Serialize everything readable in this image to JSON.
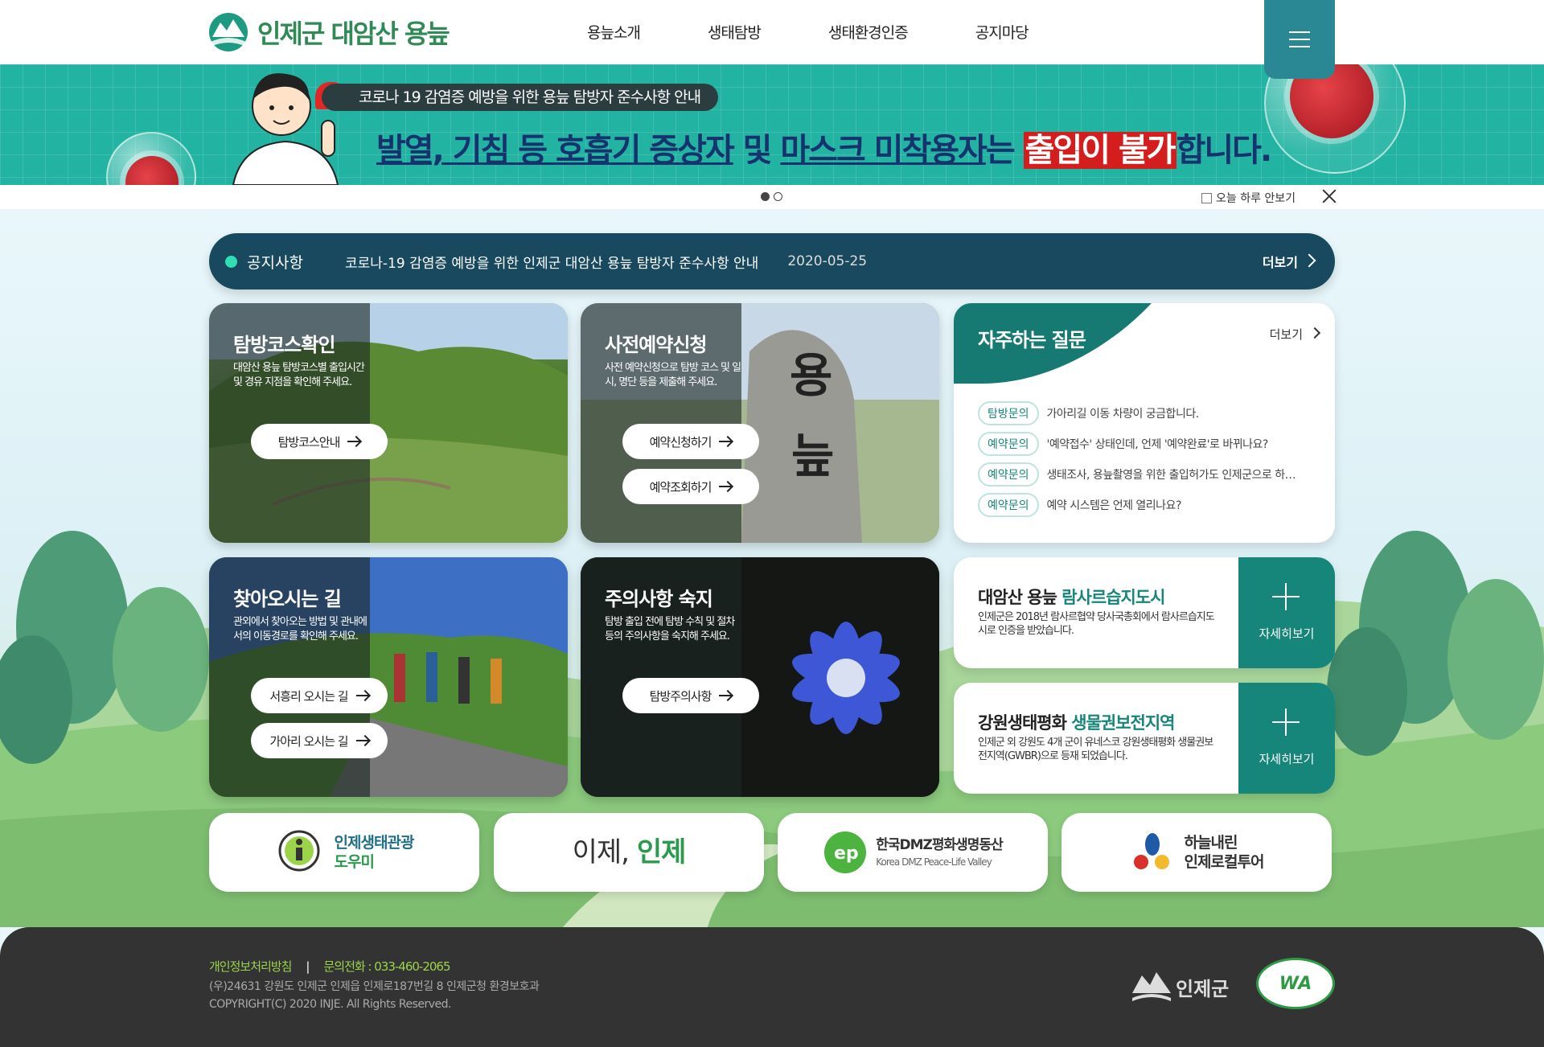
{
  "header": {
    "logo_text": "인제군 대암산 용늪",
    "nav": [
      "용늪소개",
      "생태탐방",
      "생태환경인증",
      "공지마당"
    ],
    "menu_icon": "hamburger-icon"
  },
  "banner": {
    "pill": "코로나 19 감염증 예방을 위한 용늪 탐방자 준수사항 안내",
    "headline_1": "발열, 기침 등 호흡기 증상자",
    "headline_2": " 및 ",
    "headline_3": "마스크 미착용자",
    "headline_4": "는 ",
    "headline_5": "출입이 불가",
    "headline_6": "합니다.",
    "slide_count": 2,
    "active_slide": 1,
    "today_hide": "오늘 하루 안보기"
  },
  "notice": {
    "label": "공지사항",
    "text": "코로나-19 감염증 예방을 위한 인제군 대암산 용늪 탐방자 준수사항 안내",
    "date": "2020-05-25",
    "more": "더보기"
  },
  "cards": [
    {
      "title": "탐방코스확인",
      "desc": "대암산 용늪 탐방코스별 출입시간 및 경유 지점을 확인해 주세요.",
      "buttons": [
        "탐방코스안내"
      ]
    },
    {
      "title": "사전예약신청",
      "desc": "사전 예약신청으로 탐방 코스 및 일시, 명단 등을 제출해 주세요.",
      "buttons": [
        "예약신청하기",
        "예약조회하기"
      ]
    },
    {
      "title": "찾아오시는 길",
      "desc": "관외에서 찾아오는 방법 및 관내에서의 이동경로를 확인해 주세요.",
      "buttons": [
        "서흥리 오시는 길",
        "가아리 오시는 길"
      ]
    },
    {
      "title": "주의사항 숙지",
      "desc": "탐방 출입 전에 탐방 수칙 및 절차 등의 주의사항을 숙지해 주세요.",
      "buttons": [
        "탐방주의사항"
      ]
    }
  ],
  "faq": {
    "title": "자주하는 질문",
    "more": "더보기",
    "items": [
      {
        "tag": "탐방문의",
        "q": "가아리길 이동 차량이 궁금합니다."
      },
      {
        "tag": "예약문의",
        "q": "'예약접수' 상태인데, 언제 '예약완료'로 바뀌나요?"
      },
      {
        "tag": "예약문의",
        "q": "생태조사, 용늪촬영을 위한 출입허가도 인제군으로 하나요?"
      },
      {
        "tag": "예약문의",
        "q": "예약 시스템은 언제 열리나요?"
      }
    ]
  },
  "info": [
    {
      "title_a": "대암산 용늪 ",
      "title_b": "람사르습지도시",
      "desc": "인제군은 2018년 람사르협약 당사국총회에서 람사르습지도시로 인증을 받았습니다.",
      "button": "자세히보기"
    },
    {
      "title_a": "강원생태평화 ",
      "title_b": "생물권보전지역",
      "desc": "인제군 외 강원도 4개 군이 유네스코 강원생태평화 생물권보전지역(GWBR)으로 등재 되었습니다.",
      "button": "자세히보기"
    }
  ],
  "quick_links": [
    {
      "line1": "인제생태관광",
      "line2": "도우미"
    },
    {
      "line1": "이제, ",
      "line2": "인제"
    },
    {
      "line1": "한국DMZ평화생명동산",
      "line2": "Korea DMZ Peace-Life Valley"
    },
    {
      "line1": "하늘내린",
      "line2": "인제로컬투어"
    }
  ],
  "footer": {
    "privacy": "개인정보처리방침",
    "phone": "문의전화 : 033-460-2065",
    "address": "(우)24631 강원도 인제군 인제읍 인제로187번길 8 인제군청 환경보호과",
    "copyright": "COPYRIGHT(C) 2020 INJE. All Rights Reserved.",
    "logo": "인제군",
    "wa_mark": "WA"
  },
  "colors": {
    "primary": "#16857a",
    "notice_bg": "#18495e",
    "banner_bg": "#22b3a2",
    "footer_bg": "#333333"
  }
}
